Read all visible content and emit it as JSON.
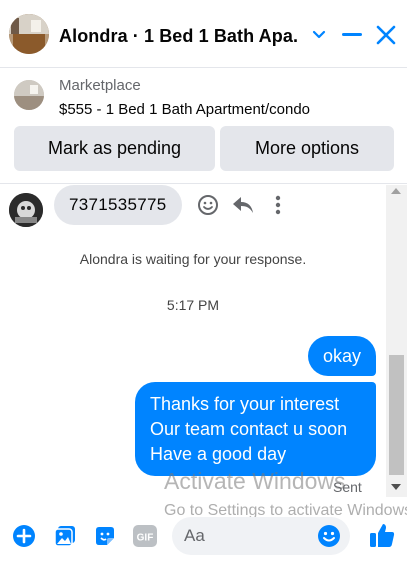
{
  "header": {
    "title": "Alondra · 1 Bed 1 Bath Apa...",
    "avatar_icon": "apartment-photo-avatar",
    "icons": [
      "chevron-down-icon",
      "minimize-icon",
      "close-icon"
    ],
    "accent": "#0084ff"
  },
  "marketplace": {
    "label": "Marketplace",
    "item": "$555 - 1 Bed 1 Bath Apartment/condo",
    "buttons": {
      "pending": "Mark as pending",
      "more": "More options"
    }
  },
  "conversation": {
    "incoming_message": "7371535775",
    "waiting_notice": "Alondra is waiting for your response.",
    "timestamp": "5:17 PM",
    "outgoing": [
      {
        "lines": [
          "okay"
        ]
      },
      {
        "lines": [
          "Thanks for your interest",
          "Our team contact u soon",
          "Have a good day"
        ]
      }
    ],
    "status": "Sent"
  },
  "overlay": {
    "activate_title": "Activate Windows",
    "activate_sub": "Go to Settings to activate Windows."
  },
  "composer": {
    "placeholder": "Aa",
    "icons": [
      "add-icon",
      "photo-icon",
      "sticker-icon",
      "gif-icon",
      "emoji-icon",
      "like-icon"
    ]
  }
}
